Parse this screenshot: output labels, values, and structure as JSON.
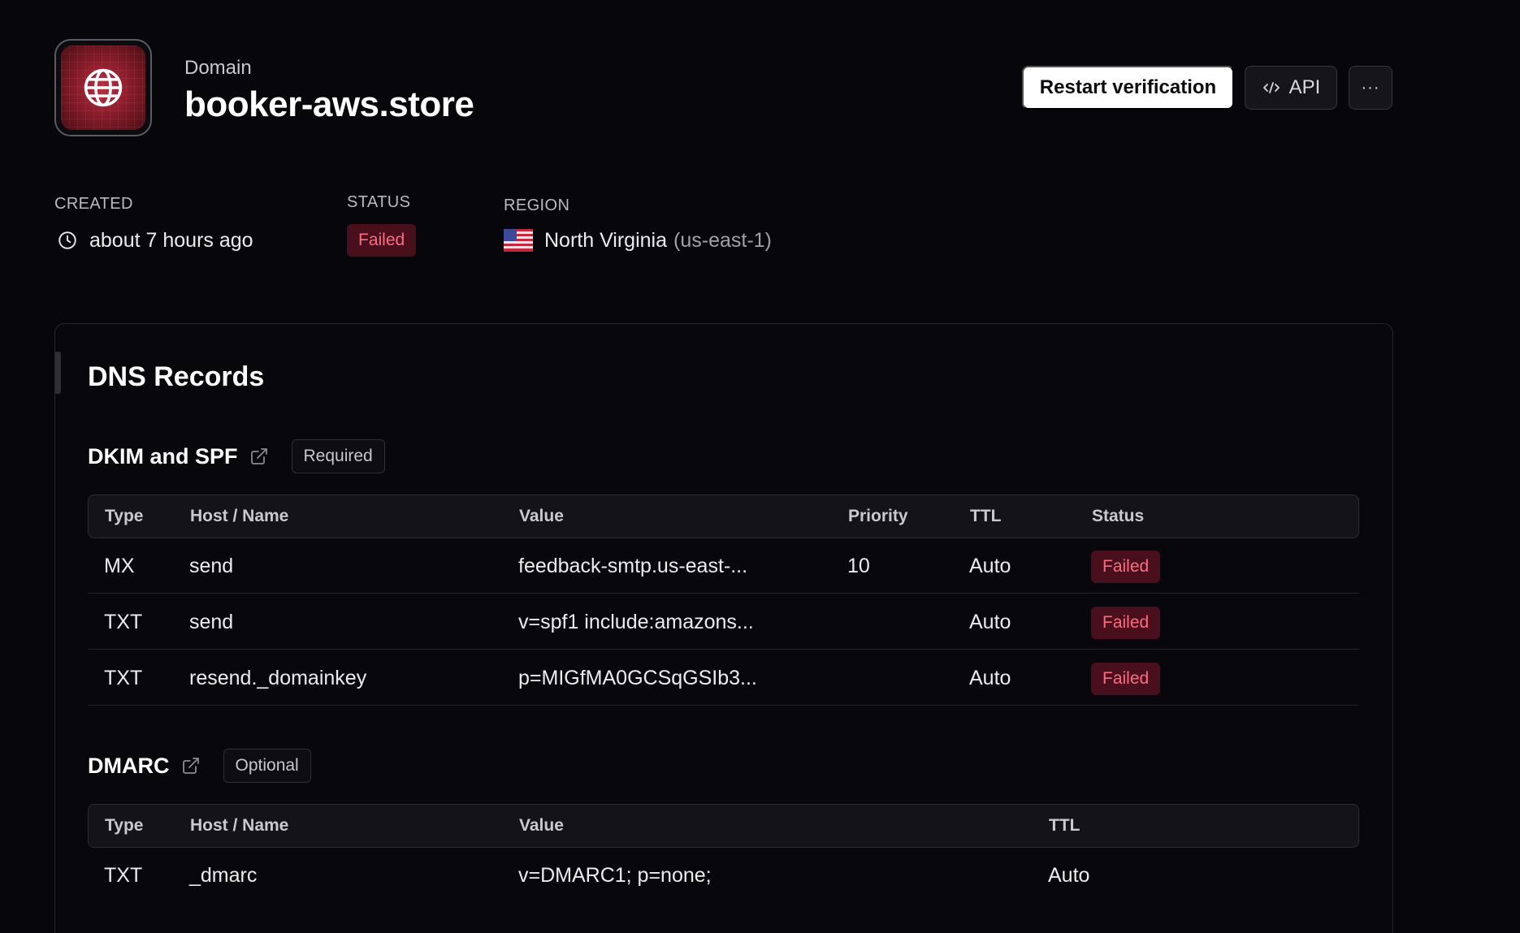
{
  "header": {
    "eyebrow": "Domain",
    "title": "booker-aws.store",
    "icon": "globe-icon",
    "actions": {
      "restart_label": "Restart verification",
      "api_label": "API",
      "api_icon": "code-icon",
      "more_label": "···"
    }
  },
  "meta": {
    "created_label": "CREATED",
    "created_value": "about 7 hours ago",
    "status_label": "STATUS",
    "status_value": "Failed",
    "region_label": "REGION",
    "region_name": "North Virginia",
    "region_code": "(us-east-1)",
    "region_flag": "us-flag-icon"
  },
  "dns": {
    "title": "DNS Records",
    "dkim": {
      "title": "DKIM and SPF",
      "tag": "Required",
      "columns": [
        "Type",
        "Host / Name",
        "Value",
        "Priority",
        "TTL",
        "Status"
      ],
      "rows": [
        {
          "type": "MX",
          "host": "send",
          "value": "feedback-smtp.us-east-...",
          "priority": "10",
          "ttl": "Auto",
          "status": "Failed"
        },
        {
          "type": "TXT",
          "host": "send",
          "value": "v=spf1 include:amazons...",
          "priority": "",
          "ttl": "Auto",
          "status": "Failed"
        },
        {
          "type": "TXT",
          "host": "resend._domainkey",
          "value": "p=MIGfMA0GCSqGSIb3...",
          "priority": "",
          "ttl": "Auto",
          "status": "Failed"
        }
      ]
    },
    "dmarc": {
      "title": "DMARC",
      "tag": "Optional",
      "columns": [
        "Type",
        "Host / Name",
        "Value",
        "TTL"
      ],
      "rows": [
        {
          "type": "TXT",
          "host": "_dmarc",
          "value": "v=DMARC1; p=none;",
          "ttl": "Auto"
        }
      ]
    }
  },
  "colors": {
    "background": "#07070b",
    "failed_bg": "#4a0f1c",
    "failed_text": "#ff6b80",
    "icon_red": "#b83040"
  }
}
